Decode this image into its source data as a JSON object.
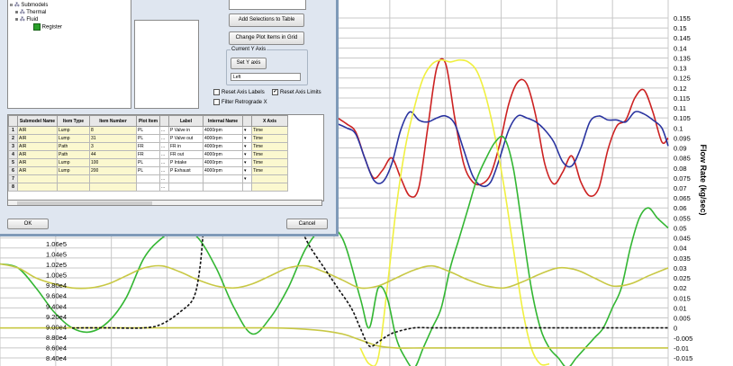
{
  "dialog": {
    "tree": {
      "items": [
        {
          "toggle": "⊟",
          "label": "Submodels",
          "level": 0
        },
        {
          "toggle": "⊞",
          "label": "Thermal",
          "level": 1
        },
        {
          "toggle": "⊞",
          "label": "Fluid",
          "level": 1
        },
        {
          "toggle": "",
          "label": "Register",
          "level": 2
        }
      ]
    },
    "buttons": {
      "add_selections": "Add Selections to Table",
      "change_plot_items": "Change Plot Items in Grid",
      "set_y_axis": "Set Y axis",
      "ok": "OK",
      "cancel": "Cancel"
    },
    "current_y_axis": {
      "title": "Current Y Axis",
      "value": "Left"
    },
    "checkboxes": [
      {
        "label": "Reset Axis Labels",
        "checked": false
      },
      {
        "label": "Reset Axis Limits",
        "checked": true
      },
      {
        "label": "Filter Retrograde X",
        "checked": false
      }
    ],
    "table": {
      "columns": [
        "",
        "Submodel Name",
        "Item Type",
        "Item Number",
        "Plot Item",
        "",
        "Label",
        "Internal Name",
        "",
        "X Axis"
      ],
      "rows": [
        [
          "1",
          "AIR",
          "Lump",
          "8",
          "PL",
          "...",
          "P Valve in",
          "4000rpm",
          "▾",
          "Time"
        ],
        [
          "2",
          "AIR",
          "Lump",
          "31",
          "PL",
          "...",
          "P Valve out",
          "4000rpm",
          "▾",
          "Time"
        ],
        [
          "3",
          "AIR",
          "Path",
          "3",
          "FR",
          "...",
          "FR in",
          "4000rpm",
          "▾",
          "Time"
        ],
        [
          "4",
          "AIR",
          "Path",
          "44",
          "FR",
          "...",
          "FR out",
          "4000rpm",
          "▾",
          "Time"
        ],
        [
          "5",
          "AIR",
          "Lump",
          "100",
          "PL",
          "...",
          "P Intake",
          "4000rpm",
          "▾",
          "Time"
        ],
        [
          "6",
          "AIR",
          "Lump",
          "200",
          "PL",
          "...",
          "P Exhaust",
          "4000rpm",
          "▾",
          "Time"
        ],
        [
          "7",
          "",
          "",
          "",
          "",
          "...",
          "",
          "",
          "▾",
          ""
        ],
        [
          "8",
          "",
          "",
          "",
          "",
          "...",
          "",
          "",
          "",
          ""
        ]
      ]
    }
  },
  "chart_data": {
    "type": "line",
    "ylabel_right": "Flow Rate (kg/sec)",
    "grid": true,
    "left_axis": {
      "visible_ticks": [
        "1.06e5",
        "1.04e5",
        "1.02e5",
        "1.00e5",
        "9.80e4",
        "9.60e4",
        "9.40e4",
        "9.20e4",
        "9.00e4",
        "8.80e4",
        "8.60e4",
        "8.40e4"
      ]
    },
    "right_axis": {
      "ticks": [
        "0.155",
        "0.15",
        "0.145",
        "0.14",
        "0.135",
        "0.13",
        "0.125",
        "0.12",
        "0.115",
        "0.11",
        "0.105",
        "0.1",
        "0.095",
        "0.09",
        "0.085",
        "0.08",
        "0.075",
        "0.07",
        "0.065",
        "0.06",
        "0.055",
        "0.05",
        "0.045",
        "0.04",
        "0.035",
        "0.03",
        "0.025",
        "0.02",
        "0.015",
        "0.01",
        "0.005",
        "0",
        "-0.005",
        "-0.01",
        "-0.015"
      ],
      "ylim": [
        -0.015,
        0.155
      ]
    },
    "series": [
      {
        "color": "#cc2222",
        "axis": "right",
        "x": [
          375,
          385,
          395,
          405,
          415,
          425,
          435,
          445,
          455,
          465,
          475,
          485,
          495,
          505,
          515,
          525,
          535,
          545,
          555,
          565,
          575,
          585,
          595,
          605,
          615,
          625,
          635,
          645,
          655,
          665,
          675,
          685,
          695,
          705,
          715,
          725,
          735,
          742
        ],
        "y": [
          0.105,
          0.102,
          0.098,
          0.085,
          0.075,
          0.079,
          0.085,
          0.075,
          0.066,
          0.07,
          0.1,
          0.13,
          0.132,
          0.105,
          0.082,
          0.073,
          0.072,
          0.077,
          0.092,
          0.112,
          0.123,
          0.122,
          0.106,
          0.082,
          0.072,
          0.078,
          0.086,
          0.073,
          0.066,
          0.07,
          0.089,
          0.101,
          0.104,
          0.115,
          0.119,
          0.108,
          0.093,
          0.095
        ]
      },
      {
        "color": "#2a34a0",
        "axis": "right",
        "x": [
          375,
          385,
          395,
          405,
          415,
          425,
          435,
          445,
          455,
          465,
          475,
          485,
          495,
          505,
          515,
          525,
          535,
          545,
          555,
          565,
          575,
          585,
          595,
          605,
          615,
          625,
          635,
          645,
          655,
          665,
          675,
          685,
          695,
          705,
          715,
          725,
          735,
          742
        ],
        "y": [
          0.102,
          0.1,
          0.097,
          0.085,
          0.074,
          0.073,
          0.082,
          0.099,
          0.108,
          0.104,
          0.103,
          0.105,
          0.106,
          0.102,
          0.089,
          0.076,
          0.071,
          0.073,
          0.085,
          0.099,
          0.106,
          0.105,
          0.103,
          0.099,
          0.093,
          0.083,
          0.081,
          0.09,
          0.103,
          0.106,
          0.104,
          0.104,
          0.103,
          0.108,
          0.107,
          0.104,
          0.1,
          0.091
        ]
      },
      {
        "color": "#f0f040",
        "axis": "right",
        "x": [
          400,
          410,
          420,
          430,
          440,
          450,
          460,
          470,
          480,
          490,
          500,
          510,
          520,
          530,
          540,
          550,
          560,
          570,
          580,
          590,
          600,
          610
        ],
        "y": [
          -0.01,
          -0.018,
          -0.015,
          0.02,
          0.06,
          0.09,
          0.11,
          0.125,
          0.132,
          0.134,
          0.133,
          0.134,
          0.133,
          0.128,
          0.115,
          0.095,
          0.07,
          0.04,
          0.01,
          -0.01,
          -0.018,
          -0.018
        ]
      },
      {
        "color": "#33b633",
        "axis": "right",
        "x": [
          0,
          20,
          40,
          60,
          80,
          100,
          120,
          140,
          160,
          180,
          200,
          220,
          240,
          260,
          280,
          300,
          320,
          340,
          360,
          380,
          400,
          410,
          420,
          430,
          440,
          450,
          460,
          470,
          480,
          490,
          500,
          510,
          520,
          530,
          540,
          550,
          560,
          570,
          580,
          590,
          600,
          610,
          620,
          630,
          640,
          650,
          660,
          670,
          680,
          690,
          700,
          710,
          720,
          730,
          742
        ],
        "y": [
          0.032,
          0.03,
          0.02,
          0.008,
          0.0,
          -0.002,
          0.003,
          0.015,
          0.035,
          0.045,
          0.05,
          0.045,
          0.03,
          0.01,
          -0.003,
          0.005,
          0.02,
          0.04,
          0.05,
          0.045,
          0.015,
          0.0,
          0.02,
          0.015,
          -0.005,
          -0.015,
          -0.02,
          -0.01,
          0.0,
          0.01,
          0.03,
          0.045,
          0.06,
          0.075,
          0.085,
          0.093,
          0.095,
          0.08,
          0.05,
          0.02,
          0.0,
          -0.01,
          -0.015,
          -0.02,
          -0.015,
          -0.01,
          -0.005,
          0.0,
          0.01,
          0.02,
          0.04,
          0.055,
          0.06,
          0.055,
          0.05
        ]
      },
      {
        "color": "#c8c844",
        "axis": "right",
        "x": [
          0,
          20,
          40,
          60,
          80,
          100,
          120,
          140,
          160,
          180,
          200,
          220,
          240,
          260,
          280,
          300,
          320,
          340,
          360,
          380,
          400,
          420,
          440,
          460,
          480,
          500,
          520,
          540,
          560,
          580,
          600,
          620,
          640,
          660,
          680,
          700,
          720,
          742
        ],
        "y": [
          0.032,
          0.03,
          0.025,
          0.022,
          0.02,
          0.02,
          0.022,
          0.026,
          0.03,
          0.031,
          0.028,
          0.024,
          0.021,
          0.02,
          0.022,
          0.026,
          0.03,
          0.031,
          0.028,
          0.024,
          0.02,
          0.021,
          0.025,
          0.029,
          0.031,
          0.028,
          0.024,
          0.021,
          0.02,
          0.023,
          0.027,
          0.03,
          0.029,
          0.025,
          0.021,
          0.022,
          0.026,
          0.03
        ]
      },
      {
        "color": "#c8c844",
        "axis": "right",
        "x": [
          0,
          200,
          300,
          350,
          380,
          400,
          420,
          440,
          470,
          500,
          540,
          600,
          640,
          700,
          742
        ],
        "y": [
          0.0,
          0.0,
          0.0,
          -0.001,
          -0.003,
          -0.006,
          -0.009,
          -0.01,
          -0.01,
          -0.01,
          -0.01,
          -0.01,
          -0.01,
          -0.01,
          -0.01
        ]
      },
      {
        "color": "#111111",
        "axis": "right",
        "x": [
          80,
          120,
          160,
          180,
          200,
          215,
          222,
          226
        ],
        "y": [
          0.0,
          0.0,
          0.0,
          0.002,
          0.008,
          0.015,
          0.03,
          0.05
        ],
        "dash": true
      },
      {
        "color": "#111111",
        "axis": "right",
        "x": [
          315,
          325,
          335,
          345,
          360,
          375,
          390,
          400,
          410,
          420,
          430,
          440,
          460,
          480,
          500,
          560,
          620,
          700,
          742
        ],
        "y": [
          0.049,
          0.051,
          0.048,
          0.04,
          0.03,
          0.02,
          0.01,
          0.0,
          -0.009,
          -0.007,
          -0.004,
          -0.002,
          0.0,
          0.0,
          0.0,
          0.0,
          0.0,
          0.0,
          0.0
        ],
        "dash": true
      }
    ]
  }
}
